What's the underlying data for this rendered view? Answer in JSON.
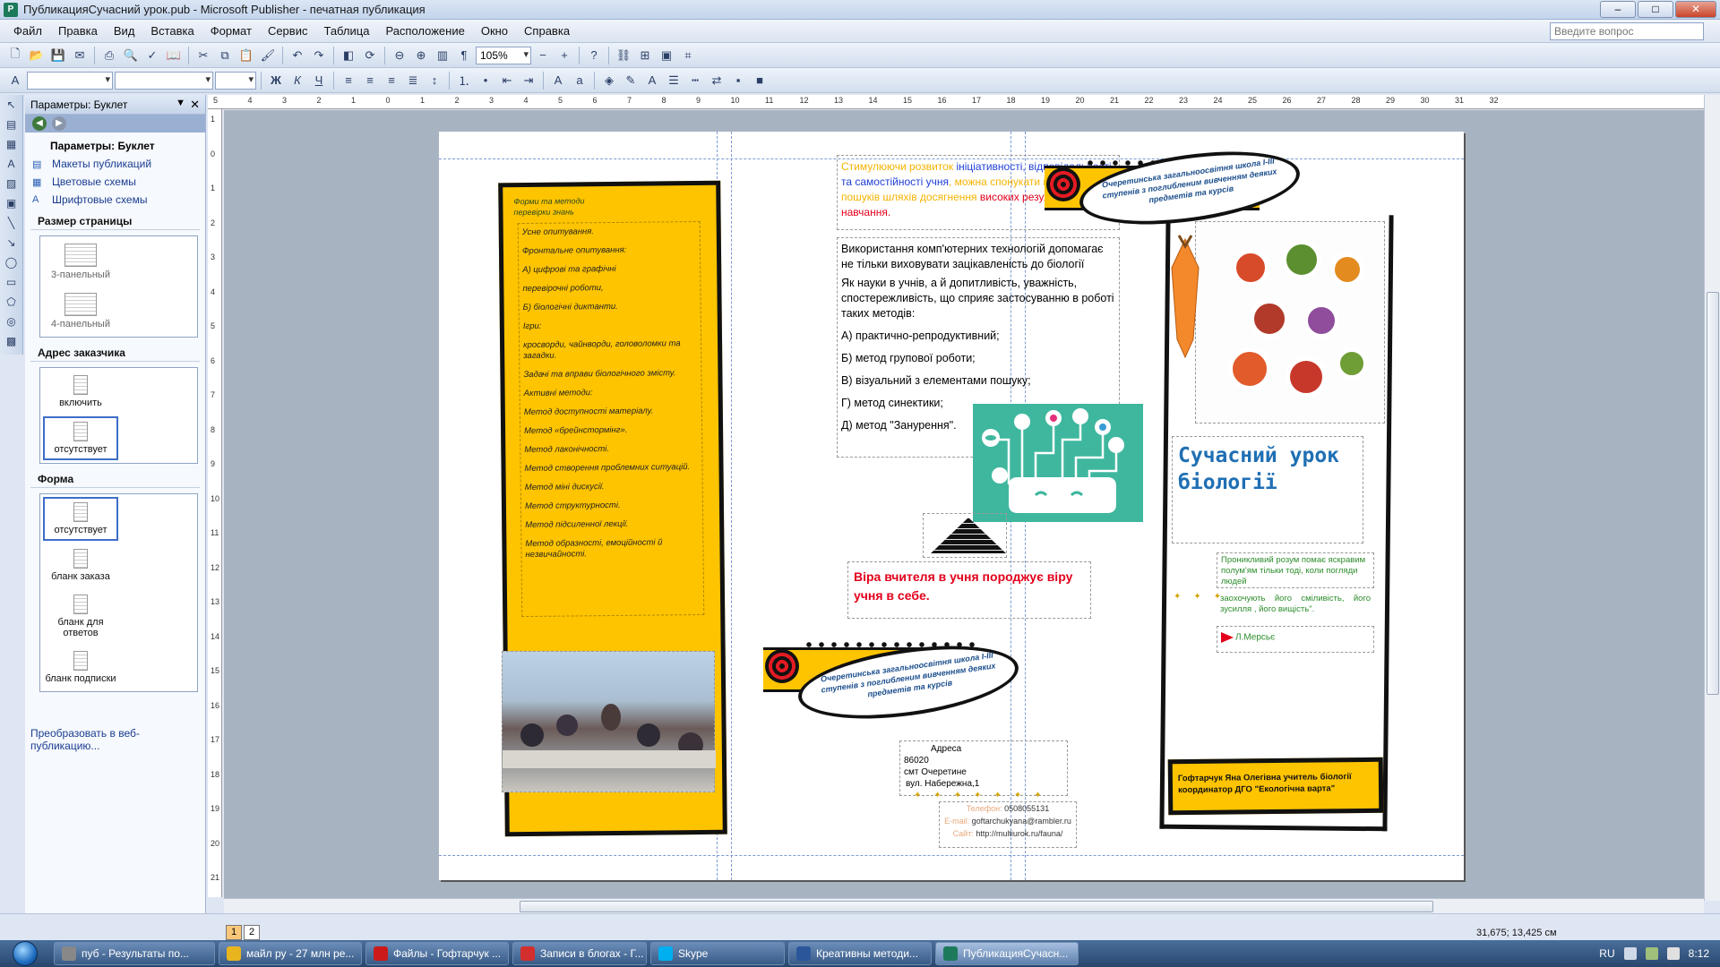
{
  "window": {
    "title": "ПубликацияСучасний урок.pub - Microsoft Publisher - печатная публикация",
    "app_icon": "P"
  },
  "menu": {
    "items": [
      "Файл",
      "Правка",
      "Вид",
      "Вставка",
      "Формат",
      "Сервис",
      "Таблица",
      "Расположение",
      "Окно",
      "Справка"
    ],
    "ask_placeholder": "Введите вопрос"
  },
  "toolbar": {
    "zoom": "105%"
  },
  "taskpane": {
    "header": "Параметры: Буклет",
    "title": "Параметры: Буклет",
    "links": [
      "Макеты публикаций",
      "Цветовые схемы",
      "Шрифтовые схемы"
    ],
    "page_size_label": "Размер страницы",
    "page_size_options": [
      "3-панельный",
      "4-панельный"
    ],
    "address_label": "Адрес заказчика",
    "address_options": [
      "включить",
      "отсутствует"
    ],
    "form_label": "Форма",
    "form_options": [
      "отсутствует",
      "бланк заказа",
      "бланк для ответов",
      "бланк подписки"
    ],
    "convert_link": "Преобразовать в веб-публикацию..."
  },
  "rulers": {
    "h_ticks": [
      "5",
      "4",
      "3",
      "2",
      "1",
      "0",
      "1",
      "2",
      "3",
      "4",
      "5",
      "6",
      "7",
      "8",
      "9",
      "10",
      "11",
      "12",
      "13",
      "14",
      "15",
      "16",
      "17",
      "18",
      "19",
      "20",
      "21",
      "22",
      "23",
      "24",
      "25",
      "26",
      "27",
      "28",
      "29",
      "30",
      "31",
      "32"
    ],
    "v_ticks": [
      "1",
      "0",
      "1",
      "2",
      "3",
      "4",
      "5",
      "6",
      "7",
      "8",
      "9",
      "10",
      "11",
      "12",
      "13",
      "14",
      "15",
      "16",
      "17",
      "18",
      "19",
      "20",
      "21"
    ]
  },
  "brochure": {
    "left_panel": {
      "heading": "Форми та методи перевірки знань",
      "lines": [
        "Усне опитування.",
        "Фронтальне опитування:",
        "А) цифрові та графічні",
        "перевірочні роботи,",
        "Б) біологічні диктанти.",
        "Ігри:",
        "кросворди, чайнворди, головоломки та загадки.",
        "Задачі та вправи біологічного змісту.",
        "Активні методи:",
        "Метод доступності матеріалу.",
        "Метод «брейнстормінг».",
        "Метод лаконічності.",
        "Метод створення проблемних ситуацій.",
        "Метод міні дискусії.",
        "Метод структурності.",
        "Метод підсиленної лекції.",
        "Метод образності, емоційності й незвичайності."
      ]
    },
    "middle_panel": {
      "intro_parts": [
        {
          "text": "Стимулюючи розвиток ",
          "color": "#f4b400"
        },
        {
          "text": "ініціативності, відповідальності та самостійності учня",
          "color": "#1f3fd6"
        },
        {
          "text": ", можна спонукати його до пошуків шляхів досягнення ",
          "color": "#f4b400"
        },
        {
          "text": "високих результатів навчання",
          "color": "#e3001b"
        },
        {
          "text": ".",
          "color": "#e3001b"
        }
      ],
      "body": [
        "Використання комп'ютерних технологій допомагає не тільки виховувати зацікавленість до біології",
        "Як науки в учнів, а й допитливість, уважність, спостережливість, що сприяє застосуванню в роботі таких методів:",
        "А) практично-репродуктивний;",
        "Б) метод групової роботи;",
        "В) візуальний з елементами пошуку;",
        "Г) метод синектики;",
        "Д) метод \"Занурення\"."
      ],
      "red_quote": "Віра вчителя в учня породжує віру учня в себе.",
      "banner_text": "Очеретинська загальноосвітня школа І-ІІІ ступенів з поглибленим вивченням деяких предметів та курсів",
      "address": {
        "label": "Адреса",
        "lines": [
          "86020",
          "смт Очеретине",
          "вул. Набережна,1"
        ]
      },
      "contacts": [
        {
          "label": "Телефон:",
          "value": "0508055131"
        },
        {
          "label": "E-mail:",
          "value": "goftarchukyana@rambler.ru"
        },
        {
          "label": "Сайт:",
          "value": "http://multiurok.ru/fauna/"
        }
      ]
    },
    "right_panel": {
      "banner_text": "Очеретинська загальноосвітня школа І-ІІІ ступенів з поглибленим вивченням деяких предметів та курсів",
      "title": "Сучасний урок біології",
      "quote_1": "Проникливий розум помає яскравим полум'ям тільки тоді, коли погляди людей",
      "quote_2": "заохочують його сміливість, його зусилля , його вищість\".",
      "author": "Л.Мерсьє",
      "author_info": "Гофтарчук Яна Олегівна учитель біології координатор ДГО \"Екологічна варта\""
    },
    "colors": {
      "yellow": "#fec400",
      "red": "#e3001b",
      "blue_title": "#1f6fb4",
      "green": "#2c8d2c",
      "teal": "#3fb79f"
    }
  },
  "status": {
    "page_tabs": [
      "1",
      "2"
    ],
    "coordinates": "31,675; 13,425 см"
  },
  "taskbar": {
    "tasks": [
      {
        "label": "пуб - Результаты по...",
        "icon": "search-icon",
        "color": "#888"
      },
      {
        "label": "майл ру - 27 млн ре...",
        "icon": "chrome-icon",
        "color": "#e8b51f"
      },
      {
        "label": "Файлы - Гофтарчук ...",
        "icon": "opera-icon",
        "color": "#cc1a1a"
      },
      {
        "label": "Записи в блогах - Г...",
        "icon": "yandex-icon",
        "color": "#d32f2f"
      },
      {
        "label": "Skype",
        "icon": "skype-icon",
        "color": "#00aff0"
      },
      {
        "label": "Креативны методи...",
        "icon": "word-icon",
        "color": "#2b579a"
      },
      {
        "label": "ПубликацияСучасн...",
        "icon": "publisher-icon",
        "color": "#1c7a5b"
      }
    ],
    "lang": "RU",
    "time": "8:12"
  }
}
